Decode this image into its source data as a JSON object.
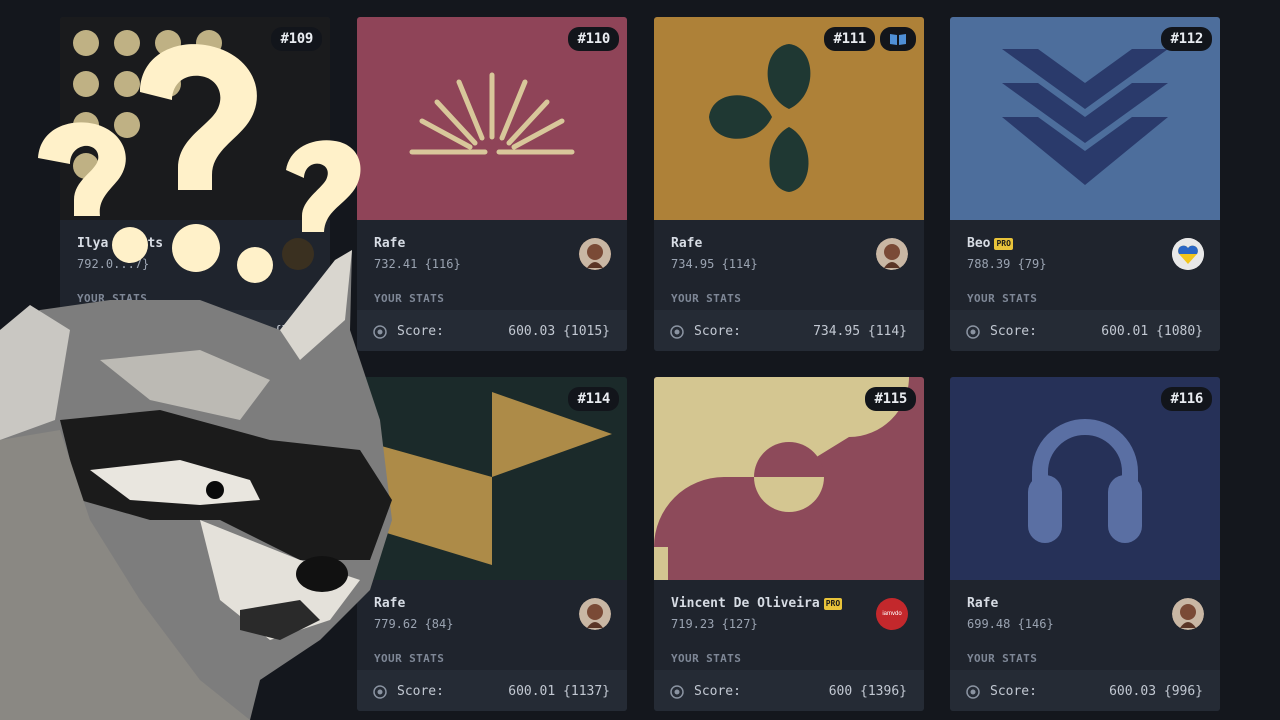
{
  "cards": [
    {
      "badge": "#109",
      "author": "Ilya ...lts",
      "rating": "792.0...7}",
      "stats_label": "YOUR STATS",
      "score_label": "Score:",
      "score_value": ".28 {761}",
      "art_colors": {
        "bg": "#1a1b1d",
        "fg": "#bfb184"
      }
    },
    {
      "badge": "#110",
      "author": "Rafe",
      "rating": "732.41 {116}",
      "stats_label": "YOUR STATS",
      "score_label": "Score:",
      "score_value": "600.03 {1015}",
      "art_colors": {
        "bg": "#8f4458",
        "fg": "#d8c79a"
      }
    },
    {
      "badge": "#111",
      "author": "Rafe",
      "rating": "734.95 {114}",
      "stats_label": "YOUR STATS",
      "score_label": "Score:",
      "score_value": "734.95 {114}",
      "art_colors": {
        "bg": "#ae8138",
        "fg": "#1f3833"
      }
    },
    {
      "badge": "#112",
      "author": "Beo",
      "pro": "PRO",
      "rating": "788.39 {79}",
      "stats_label": "YOUR STATS",
      "score_label": "Score:",
      "score_value": "600.01 {1080}",
      "art_colors": {
        "bg": "#4d6e9c",
        "fg": "#2a3a6b"
      }
    },
    {
      "badge": "#114",
      "author": "Rafe",
      "rating": "779.62 {84}",
      "stats_label": "YOUR STATS",
      "score_label": "Score:",
      "score_value": "600.01 {1137}",
      "art_colors": {
        "bg": "#1b2a2a",
        "fg": "#ad8b48"
      }
    },
    {
      "badge": "#115",
      "author": "Vincent De Oliveira",
      "pro": "PRO",
      "rating": "719.23 {127}",
      "stats_label": "YOUR STATS",
      "score_label": "Score:",
      "score_value": "600 {1396}",
      "art_colors": {
        "bg": "#d4c691",
        "fg": "#8d4a5a"
      }
    },
    {
      "badge": "#116",
      "author": "Rafe",
      "rating": "699.48 {146}",
      "stats_label": "YOUR STATS",
      "score_label": "Score:",
      "score_value": "600.03 {996}",
      "art_colors": {
        "bg": "#263158",
        "fg": "#5a6fa3"
      }
    }
  ],
  "avatar_text": "iamvdo",
  "icons": {
    "score": "target-icon",
    "book": "book-icon",
    "question": "question-mark-icon",
    "raccoon": "raccoon-image"
  }
}
